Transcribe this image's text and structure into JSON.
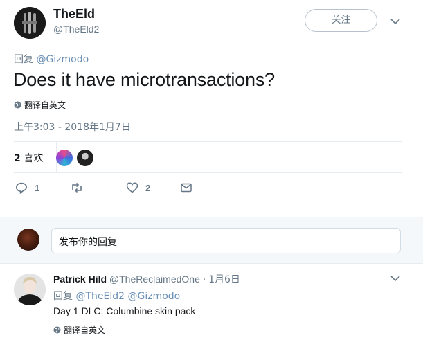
{
  "tweet": {
    "author_name": "TheEld",
    "author_handle": "@TheEld2",
    "follow_label": "关注",
    "reply_prefix": "回复",
    "reply_to_handle": "@Gizmodo",
    "text": "Does it have microtransactions?",
    "translate_label": "翻译自英文",
    "timestamp": "上午3:03 - 2018年1月7日",
    "likes_count": "2",
    "likes_label": "喜欢",
    "actions": {
      "reply_count": "1",
      "retweet_count": "",
      "like_count": "2"
    }
  },
  "composer": {
    "placeholder": "发布你的回复"
  },
  "reply": {
    "author_name": "Patrick Hild",
    "author_handle": "@TheReclaimedOne",
    "separator": "·",
    "time": "1月6日",
    "reply_prefix": "回复",
    "reply_to_handles": "@TheEld2 @Gizmodo",
    "text": "Day 1 DLC: Columbine skin pack",
    "translate_label": "翻译自英文"
  },
  "colors": {
    "secondary_text": "#657786",
    "link": "#6a8fb5",
    "divider": "#e6ecf0",
    "composer_bg": "#f5f8fa"
  },
  "icons": [
    "chevron-down-icon",
    "globe-icon",
    "reply-icon",
    "retweet-icon",
    "heart-icon",
    "envelope-icon"
  ]
}
